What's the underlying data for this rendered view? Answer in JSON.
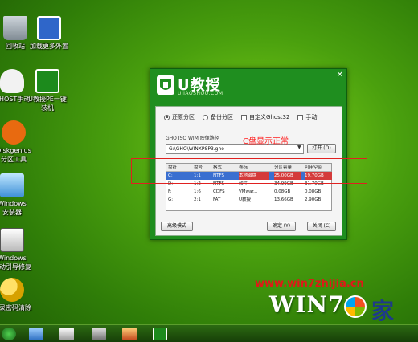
{
  "desktop_icons": [
    {
      "label": "回收站",
      "icon": "recycle-bin-icon"
    },
    {
      "label": "加载更多外置",
      "icon": "extension-icon"
    },
    {
      "label": "GHOST手动",
      "icon": "ghost-icon"
    },
    {
      "label": "U教授PE一键\n装机",
      "icon": "ujiaoshou-pe-icon"
    },
    {
      "label": "Diskgenius\n分区工具",
      "icon": "diskgenius-icon"
    },
    {
      "label": "Windows\n安装器",
      "icon": "windows-installer-icon"
    },
    {
      "label": "Windows\n启动引导修复",
      "icon": "boot-repair-icon"
    },
    {
      "label": "登录密码清除",
      "icon": "password-key-icon"
    }
  ],
  "window": {
    "close": "✕",
    "logo_text": "U教授",
    "logo_sub": "UJIAOSHOU.COM",
    "options": [
      {
        "label": "还原分区",
        "selected": true,
        "kind": "radio"
      },
      {
        "label": "备份分区",
        "selected": false,
        "kind": "radio"
      },
      {
        "label": "自定义Ghost32",
        "selected": false,
        "kind": "checkbox"
      },
      {
        "label": "手动",
        "selected": false,
        "kind": "checkbox"
      }
    ],
    "path_label": "GHO ISO WIM 映像路径",
    "path_value": "G:\\GHO\\WINXPSP3.gho",
    "path_dropdown": "▼",
    "open_button": "打开 (O)",
    "table": {
      "headers": [
        "盘符",
        "盘号",
        "格式",
        "卷标",
        "分区容量",
        "可用空间"
      ],
      "rows": [
        [
          "C:",
          "1:1",
          "NTFS",
          "本地磁盘",
          "25.00GB",
          "19.70GB"
        ],
        [
          "D:",
          "1:2",
          "NTFS",
          "软件",
          "34.99GB",
          "31.70GB"
        ],
        [
          "F:",
          "1:6",
          "CDFS",
          "VMwar...",
          "0.08GB",
          "0.08GB"
        ],
        [
          "G:",
          "2:1",
          "FAT",
          "U教授",
          "13.66GB",
          "2.90GB"
        ]
      ]
    },
    "advanced_button": "高级模式",
    "ok_button": "确定 (Y)",
    "close_button": "关闭 (C)"
  },
  "annotation": "C盘显示正常",
  "watermark": {
    "url": "www.win7zhijia.cn",
    "logo": "WIN7",
    "logo_suffix": "家"
  },
  "colors": {
    "window_green": "#1f8e1f",
    "annotation_red": "#e02020",
    "selection_blue": "#3a6fd0"
  }
}
